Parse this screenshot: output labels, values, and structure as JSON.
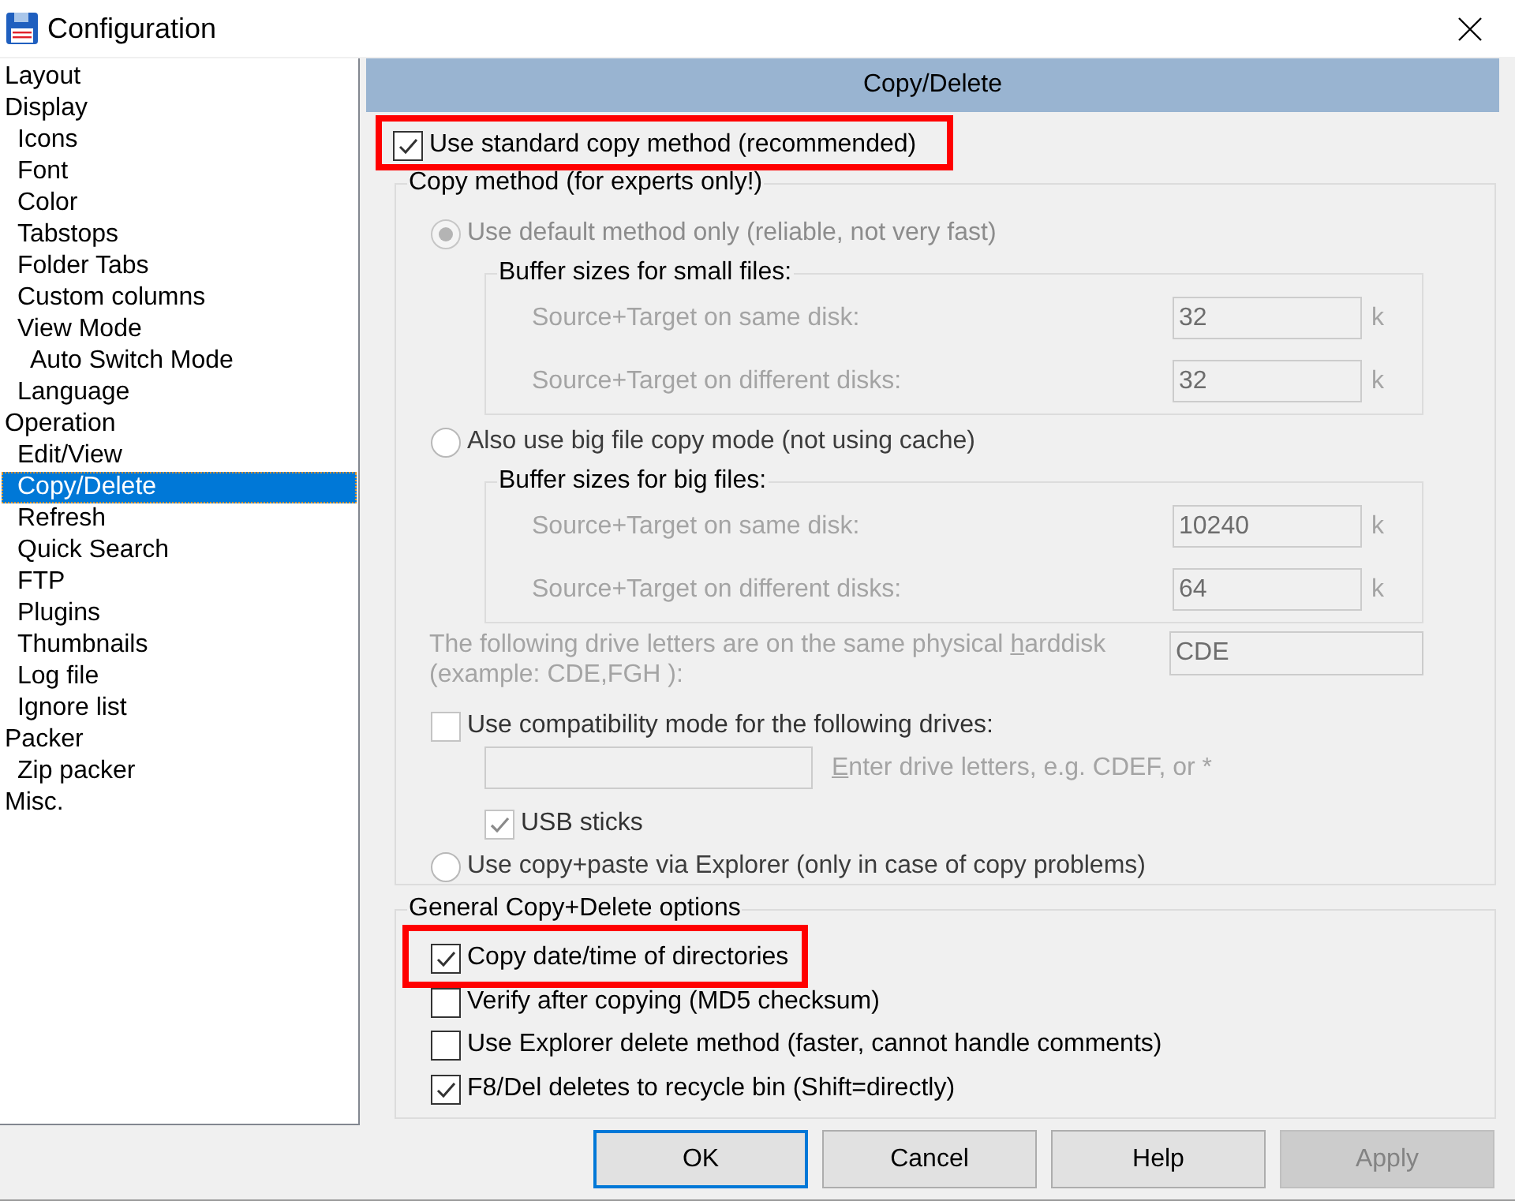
{
  "window": {
    "title": "Configuration"
  },
  "sidebar": {
    "items": [
      {
        "label": "Layout",
        "selected": false
      },
      {
        "label": "Display",
        "selected": false,
        "children": [
          {
            "label": "Icons",
            "selected": false
          },
          {
            "label": "Font",
            "selected": false
          },
          {
            "label": "Color",
            "selected": false
          },
          {
            "label": "Tabstops",
            "selected": false
          },
          {
            "label": "Folder Tabs",
            "selected": false
          },
          {
            "label": "Custom columns",
            "selected": false
          },
          {
            "label": "View Mode",
            "selected": false,
            "children": [
              {
                "label": "Auto Switch Mode",
                "selected": false
              }
            ]
          },
          {
            "label": "Language",
            "selected": false
          }
        ]
      },
      {
        "label": "Operation",
        "selected": false,
        "children": [
          {
            "label": "Edit/View",
            "selected": false
          },
          {
            "label": "Copy/Delete",
            "selected": true
          },
          {
            "label": "Refresh",
            "selected": false
          },
          {
            "label": "Quick Search",
            "selected": false
          },
          {
            "label": "FTP",
            "selected": false
          },
          {
            "label": "Plugins",
            "selected": false
          },
          {
            "label": "Thumbnails",
            "selected": false
          },
          {
            "label": "Log file",
            "selected": false
          },
          {
            "label": "Ignore list",
            "selected": false
          }
        ]
      },
      {
        "label": "Packer",
        "selected": false,
        "children": [
          {
            "label": "Zip packer",
            "selected": false
          }
        ]
      },
      {
        "label": "Misc.",
        "selected": false
      }
    ]
  },
  "page": {
    "title": "Copy/Delete",
    "standard_copy": {
      "label": "Use standard copy method (recommended)",
      "checked": true,
      "highlighted": true
    },
    "copy_method": {
      "title": "Copy method (for experts only!)",
      "items": [
        {
          "kind": "radio",
          "label": "Use default method only (reliable, not very fast)",
          "selected": true,
          "disabled": true
        },
        {
          "kind": "buffers",
          "title": "Buffer sizes for small files:",
          "rows": [
            {
              "label": "Source+Target on same disk:",
              "value": "32",
              "unit": "k"
            },
            {
              "label": "Source+Target on different disks:",
              "value": "32",
              "unit": "k"
            }
          ]
        },
        {
          "kind": "radio",
          "label": "Also use big file copy mode (not using cache)",
          "selected": false,
          "disabled": false
        },
        {
          "kind": "buffers",
          "title": "Buffer sizes for big files:",
          "rows": [
            {
              "label": "Source+Target on same disk:",
              "value": "10240",
              "unit": "k"
            },
            {
              "label": "Source+Target on different disks:",
              "value": "64",
              "unit": "k"
            }
          ]
        },
        {
          "kind": "driveletters",
          "label_start": "The following drive letters are on the same physical ",
          "access_key": "h",
          "label_end": "arddisk",
          "example": "(example: CDE,FGH ):",
          "value": "CDE"
        },
        {
          "kind": "checkbox",
          "label": "Use compatibility mode for the following drives:",
          "checked": false,
          "disabled": true
        },
        {
          "kind": "drivefield",
          "hint_access_key": "E",
          "hint_rest": "nter drive letters, e.g. CDEF, or *"
        },
        {
          "kind": "subcheckbox",
          "label": "USB sticks",
          "checked": true,
          "disabled": true
        },
        {
          "kind": "radio",
          "label": "Use copy+paste via Explorer (only in case of copy problems)",
          "selected": false,
          "disabled": false
        }
      ]
    },
    "general": {
      "title": "General Copy+Delete options",
      "options": [
        {
          "label": "Copy date/time of directories",
          "checked": true,
          "highlighted": true
        },
        {
          "label": "Verify after copying (MD5 checksum)",
          "checked": false,
          "highlighted": false
        },
        {
          "label": "Use Explorer delete method (faster, cannot handle comments)",
          "checked": false,
          "highlighted": false
        },
        {
          "label": "F8/Del deletes to recycle bin (Shift=directly)",
          "checked": true,
          "highlighted": false
        }
      ]
    }
  },
  "buttons": [
    {
      "label": "OK",
      "default": true,
      "disabled": false
    },
    {
      "label": "Cancel",
      "default": false,
      "disabled": false
    },
    {
      "label": "Help",
      "default": false,
      "disabled": false
    },
    {
      "label": "Apply",
      "default": false,
      "disabled": true
    }
  ]
}
